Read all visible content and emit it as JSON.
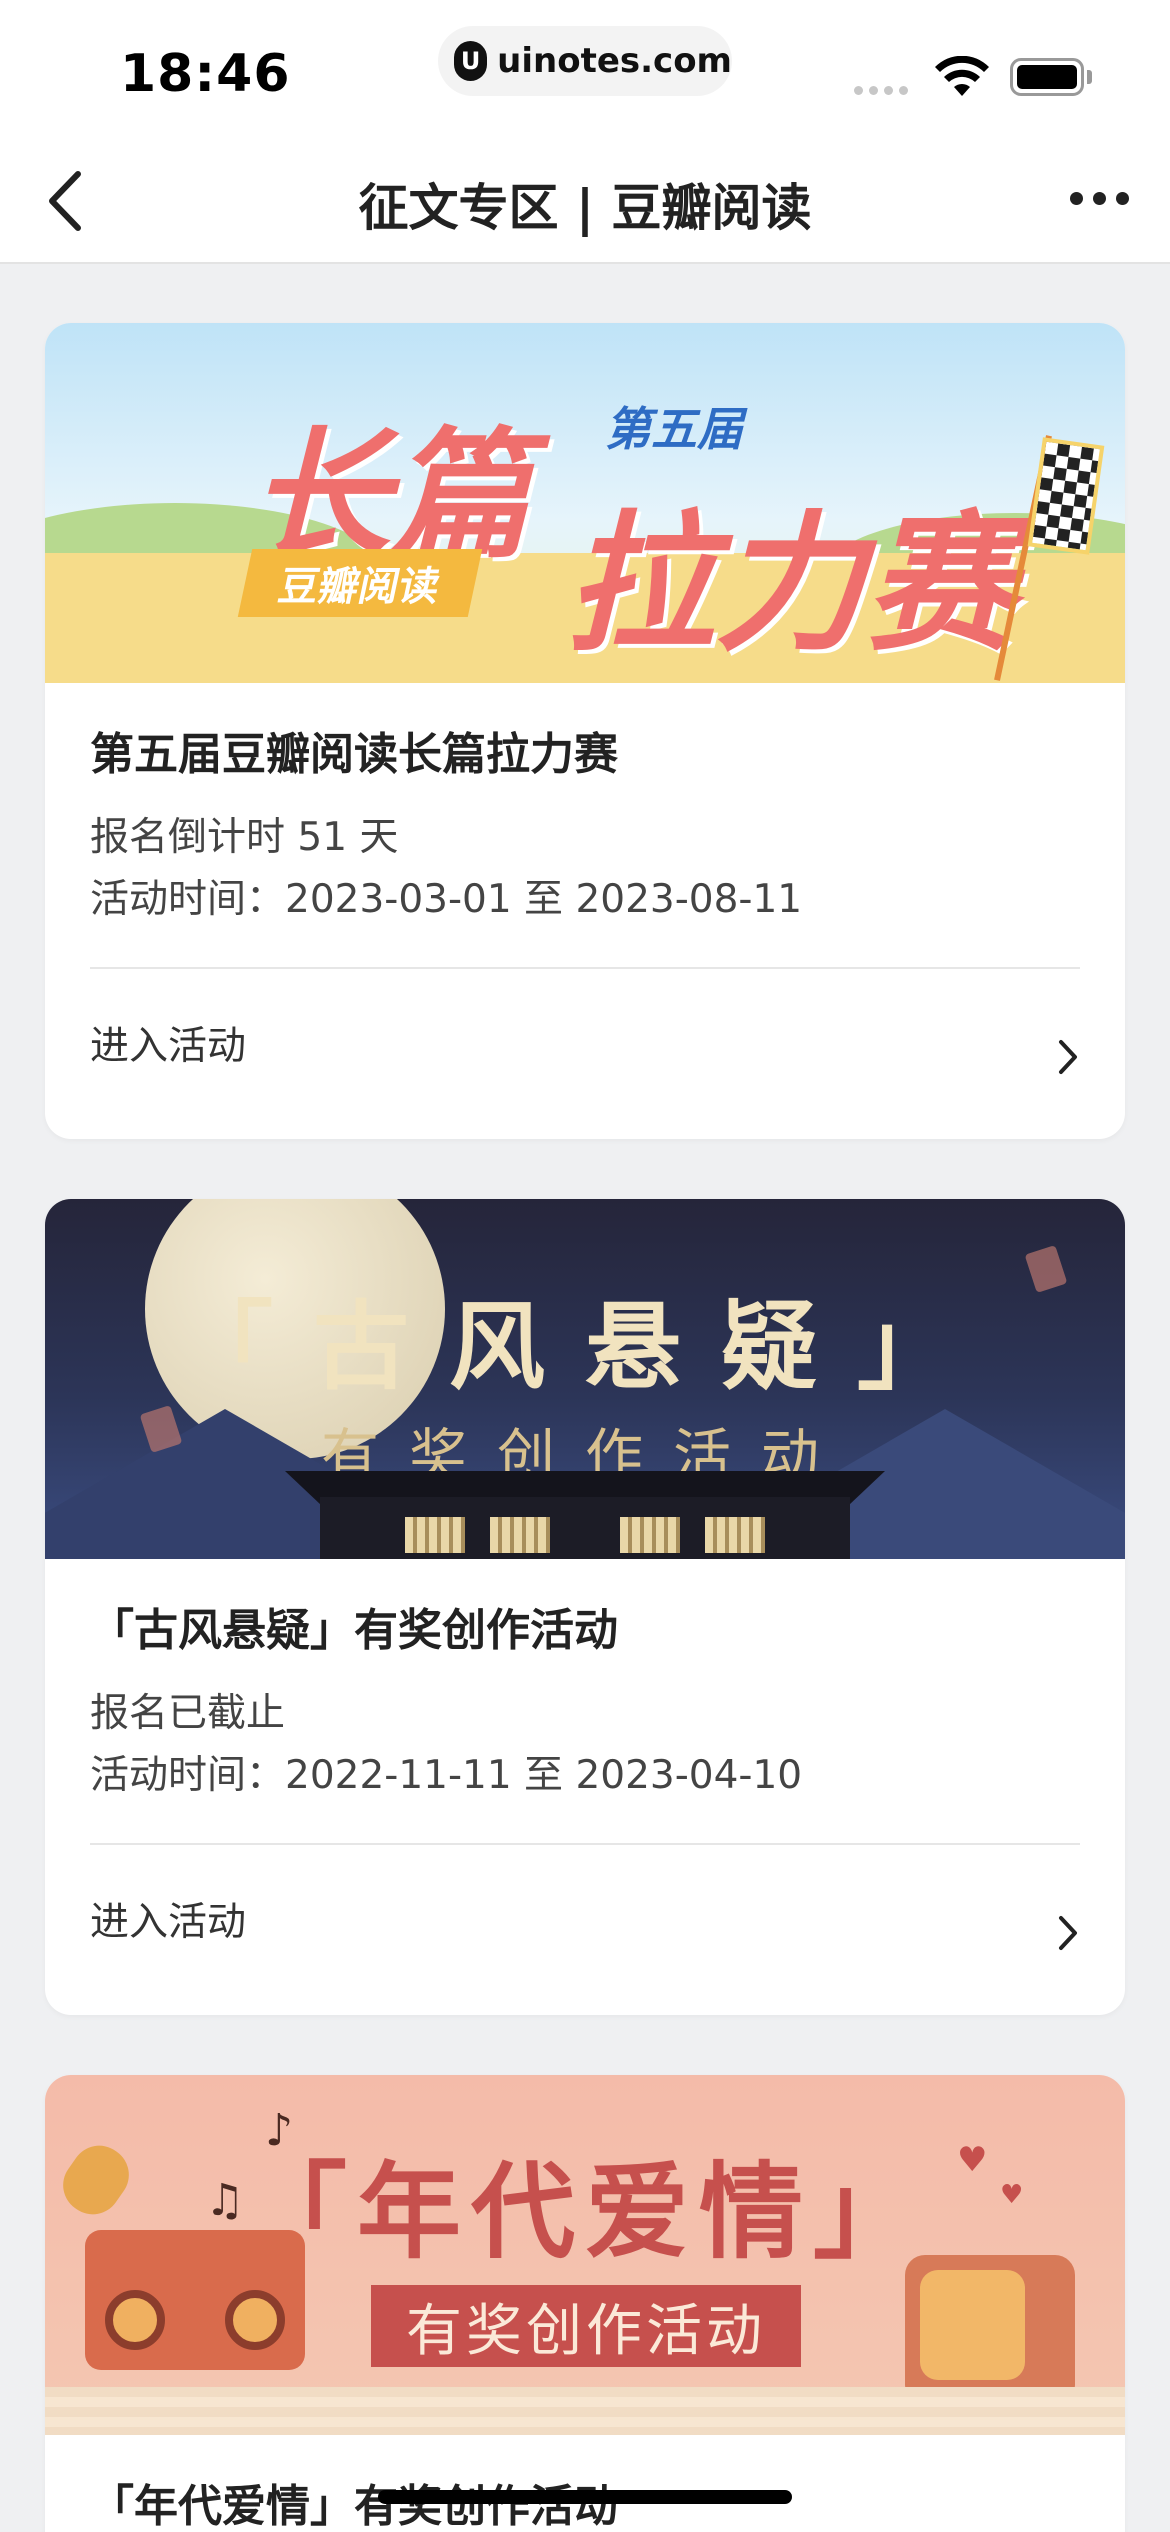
{
  "status_bar": {
    "time": "18:46",
    "watermark": "uinotes.com",
    "watermark_logo": "U"
  },
  "nav": {
    "title": "征文专区 | 豆瓣阅读",
    "back_icon": "chevron-left-icon",
    "more_icon": "more-horizontal-icon"
  },
  "cards": [
    {
      "banner": {
        "big_text_1": "长篇",
        "big_text_2": "拉力赛",
        "tag": "豆瓣阅读",
        "badge": "第五届"
      },
      "title": "第五届豆瓣阅读长篇拉力赛",
      "status": "报名倒计时 51 天",
      "period": "活动时间：2023-03-01 至 2023-08-11",
      "enter_label": "进入活动"
    },
    {
      "banner": {
        "headline": "「古风悬疑」",
        "subline": "有奖创作活动"
      },
      "title": "「古风悬疑」有奖创作活动",
      "status": "报名已截止",
      "period": "活动时间：2022-11-11 至 2023-04-10",
      "enter_label": "进入活动"
    },
    {
      "banner": {
        "headline": "「年代爱情」",
        "subline": "有奖创作活动"
      },
      "title": "「年代爱情」有奖创作活动"
    }
  ],
  "colors": {
    "accent_red": "#ef6f6d",
    "page_bg": "#eff0f2"
  }
}
